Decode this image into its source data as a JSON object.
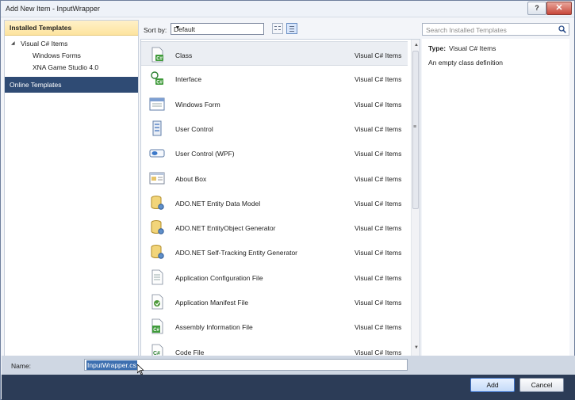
{
  "window": {
    "title": "Add New Item - InputWrapper",
    "help_label": "?",
    "close_label": "✕"
  },
  "sidebar": {
    "installed_label": "Installed Templates",
    "tree": [
      {
        "label": "Visual C# Items",
        "expander": "◢"
      },
      {
        "label": "Windows Forms"
      },
      {
        "label": "XNA Game Studio 4.0"
      }
    ],
    "online_label": "Online Templates"
  },
  "toolbar": {
    "sort_label": "Sort by:",
    "sort_value": "Default"
  },
  "search": {
    "placeholder": "Search Installed Templates"
  },
  "templates": [
    {
      "name": "Class",
      "category": "Visual C# Items",
      "icon": "class-icon",
      "selected": true
    },
    {
      "name": "Interface",
      "category": "Visual C# Items",
      "icon": "interface-icon"
    },
    {
      "name": "Windows Form",
      "category": "Visual C# Items",
      "icon": "windows-form-icon"
    },
    {
      "name": "User Control",
      "category": "Visual C# Items",
      "icon": "user-control-icon"
    },
    {
      "name": "User Control (WPF)",
      "category": "Visual C# Items",
      "icon": "wpf-control-icon"
    },
    {
      "name": "About Box",
      "category": "Visual C# Items",
      "icon": "about-box-icon"
    },
    {
      "name": "ADO.NET Entity Data Model",
      "category": "Visual C# Items",
      "icon": "database-icon"
    },
    {
      "name": "ADO.NET EntityObject Generator",
      "category": "Visual C# Items",
      "icon": "database-icon"
    },
    {
      "name": "ADO.NET Self-Tracking Entity Generator",
      "category": "Visual C# Items",
      "icon": "database-icon"
    },
    {
      "name": "Application Configuration File",
      "category": "Visual C# Items",
      "icon": "config-file-icon"
    },
    {
      "name": "Application Manifest File",
      "category": "Visual C# Items",
      "icon": "manifest-file-icon"
    },
    {
      "name": "Assembly Information File",
      "category": "Visual C# Items",
      "icon": "assembly-info-icon"
    },
    {
      "name": "Code File",
      "category": "Visual C# Items",
      "icon": "code-file-icon"
    }
  ],
  "details": {
    "type_label": "Type:",
    "type_value": "Visual C# Items",
    "description": "An empty class definition"
  },
  "name_field": {
    "label": "Name:",
    "value": "InputWrapper.cs"
  },
  "buttons": {
    "add": "Add",
    "cancel": "Cancel"
  },
  "colors": {
    "selection": "#ebeef3",
    "online_header": "#2f4b74",
    "installed_header": "#fde49f",
    "footer": "#2c3c57"
  }
}
